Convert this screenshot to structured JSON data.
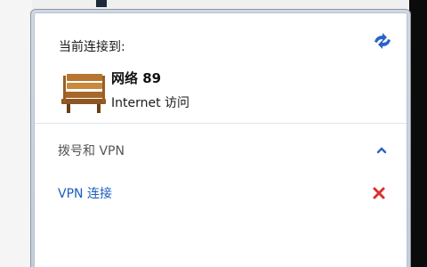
{
  "flyout": {
    "heading": "当前连接到:",
    "connection": {
      "name": "网络  89",
      "status": "Internet 访问"
    },
    "section": {
      "title": "拨号和 VPN"
    },
    "vpn": {
      "label": "VPN 连接"
    }
  },
  "icons": {
    "refresh": "refresh-icon",
    "network": "network-bench-icon",
    "collapse": "chevron-up-icon",
    "remove": "close-x-icon"
  },
  "colors": {
    "link": "#1b5dbf",
    "accent_icon": "#2a62c9",
    "delete": "#d9302e",
    "frame": "#c9d3df"
  }
}
